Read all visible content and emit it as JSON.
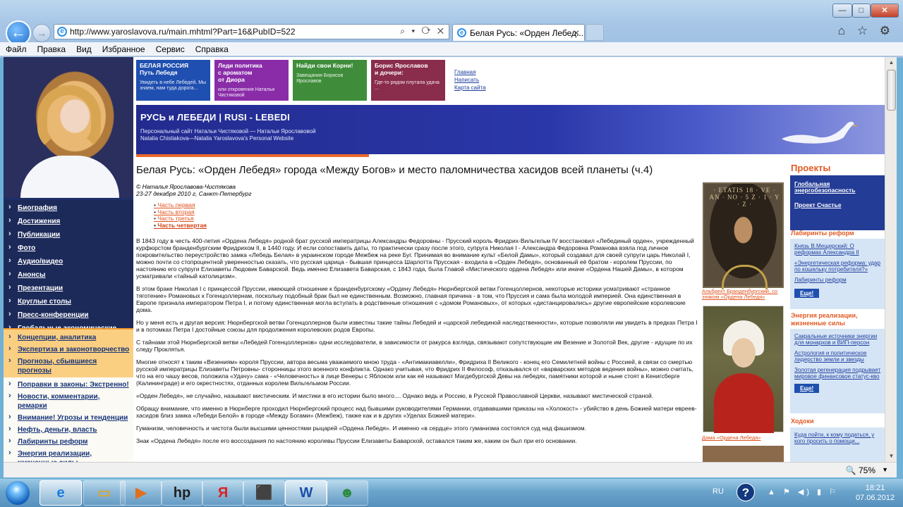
{
  "window": {
    "minimize": "—",
    "maximize": "□",
    "close": "✕"
  },
  "browser": {
    "back_icon": "arrow-left",
    "address": "http://www.yaroslavova.ru/main.mhtml?Part=16&PubID=522",
    "address_controls": "⌕ ▾ ⟳ ✕",
    "tab_title": "Белая Русь: «Орден Лебед...",
    "tab_close": "✕",
    "toolbar_icons": "⌂ ☆ ⚙"
  },
  "menu": [
    "Файл",
    "Правка",
    "Вид",
    "Избранное",
    "Сервис",
    "Справка"
  ],
  "header": {
    "banners": [
      {
        "title": "БЕЛАЯ РОССИЯ\nПуть Лебедя",
        "sub": "Увидеть в небе Лебедей, Мы знаем, нам туда дорога...",
        "color": "#1f4fb0"
      },
      {
        "title": "Леди политика\nс ароматом\nот Диора",
        "sub": "или откровения Натальи Чистяковой",
        "color": "#8a2ca8"
      },
      {
        "title": "Найди свои Корни!",
        "sub": "Завещания Борисов Ярославов",
        "color": "#3f8d3a"
      },
      {
        "title": "Борис Ярославов\nи дочери:",
        "sub": "Где-то рядом плутала удача ...",
        "color": "#8a2c4c"
      }
    ],
    "toplinks": [
      "Главная",
      "Написать",
      "Карта сайта"
    ],
    "hero_title": "РУСЬ и ЛЕБЕДИ | RUSI - LEBEDI",
    "hero_sub1": "Персональный сайт Натальи Чистяковой — Натальи Ярославовой",
    "hero_sub2": "Natalia Chistiakova—Natalia Yaroslavova's  Personal Website"
  },
  "leftnav": {
    "primary": [
      "Биография",
      "Достижения",
      "Публикации",
      "Фото",
      "Аудио/видео",
      "Анонсы",
      "Презентации",
      "Круглые столы",
      "Пресс-конференции",
      "Глобальные экономические стратегии, навигации"
    ],
    "secondary": [
      "Концепции, аналитика",
      "Экспертиза и законотворчество",
      "Прогнозы, сбывшиеся прогнозы"
    ],
    "tertiary": [
      "Поправки в законы: Экстренно!",
      "Новости, комментарии, ремарки",
      "Внимание! Угрозы и тенденции",
      "Нефть, деньги, власть",
      "Лабиринты реформ",
      "Энергия реализации, жизненные силы"
    ]
  },
  "article": {
    "title": "Белая Русь: «Орден Лебедя» города «Между Богов» и место паломничества хасидов всей планеты (ч.4)",
    "author": "© Наталья Ярославова-Чистякова",
    "date": "23-27 декабря 2010 г, Санкт-Петербург",
    "parts": [
      "Часть первая",
      "Часть вторая",
      "Часть третья",
      "Часть четвертая"
    ],
    "paragraphs": [
      "В 1843 году в честь 400-летия «Ордена Лебедя» родной брат русской императрицы Александры Федоровны - Прусский король Фридрих-Вильгельм IV восстановил «Лебединый орден», учрежденный курфюрстом бранденбургским Фридрихом II, в 1440 году. И если сопоставить даты, то практически сразу после этого, супруга Николая I - Александра Федоровна Романова взяла под личное покровительство переустройство замка «Лебедь Белая» в украинском городе Межбеж на реке Буг. Принимая во внимание культ «Белой Дамы», который создавал для своей супруги царь Николай I, можно почти со стопроцентной уверенностью сказать, что русская царица - бывшая принцесса Шарлотта Прусская - входила в «Орден Лебедя», основанный её братом - королем Пруссии, по настоянию его супруги Елизаветы Людовик Баварской. Ведь именно Елизавета Баварская, с 1843 года, была Главой «Мистического ордена Лебедя» или иначе «Ордена Нашей Дамы», в котором усматривали «тайный католицизм».",
      "В этом браке Николая I с принцессой Пруссии, имеющей отношение к бранденбургскому «Ордену Лебедя» Нюрнбергской ветви Гогенцоллернов, некоторые историки усматривают «странное тяготение» Романовых к Гогенцоллернам, поскольку подобный брак был не единственным. Возможно, главная причина - в том, что Пруссия и сама была молодой империей. Она единственная в Европе признала императором Петра I, и потому единственная могла вступать в родственные отношения с «домом Романовых», от которых «дистанцировались» другие европейские королевские дома.",
      "Но у меня есть и другая версия: Нюрнбергской ветви Гогенцоллернов были известны такие тайны Лебедей и «царской лебединой наследственности», которые позволяли им увидеть в предках Петра I и в потомках Петра I достойные союзы для продолжения королевских родов Европы.",
      "С тайнами этой Нюрнбергской ветви «Лебедей Гогенцоллернов» одни исследователи, в зависимости от ракурса взгляда, связывают сопутствующие им Везение и Золотой Век, другие - идущие по их следу Проклятья.",
      "Многие относят к таким «Везениям» короля Пруссии, автора весьма уважаемого мною труда - «Антимакиавелли», Фридриха II Великого - конец его Семилетней войны с Россией, в связи со смертью русской императрицы Елизаветы Петровны- сторонницы этого военного конфликта. Однако учитывая, что Фридрих II Философ, отказывался от «варварских методов ведения войны», можно считать, что на его чашу весов, положила «Удачу» сама - «Человечность» в лице Венеры с Яблоком или как её называют Магдебургской Девы на лебедях, памятники которой и ныне стоят в Кенигсберге (Калининграде) и его окрестностях, отданных королем Вильгельмом России.",
      "«Орден Лебедя», не случайно, называют мистическим. И мистики в его истории было много.... Однако ведь и Россию, в Русской Православной Церкви, называют мистической страной.",
      "Обращу внимание, что именно в Нюрнберге проходил Нюрнбергский процесс над бывшими руководителями Германии, отдававшими приказы на «Холокост» - убийство в день Божией матери евреев-хасидов близ замка «Лебеди Белой» в городе «Между Богами» (Межбеж), также как и в других «Уделах Божией матери».",
      "Гуманизм, человечность и чистота были высшими ценностями рыцарей «Ордена Лебедя». И именно «в сердце» этого гуманизма состоялся суд над фашизмом.",
      "Знак «Ордена Лебедя» после его воссоздания по настоянию королевы Пруссии Елизаветы Баварской, оставался таким же, каким он был при его основании."
    ],
    "image1_inscription": "· ETATIS 18 · VE · AN · NO · 5 Z · 1 · Y · Z ·",
    "image1_caption": "Альбрехт Бранденбургский, со знаком «Ордена Лебедя»",
    "image2_caption": "Дама «Ордена Лебедя»"
  },
  "sidebar": {
    "projects_title": "Проекты",
    "projects": [
      "Глобальная энергобезопасность",
      "Проект Счастье"
    ],
    "s1_title": "Лабиринты реформ",
    "s1_items": [
      "Князь В.Мещерский: О реформах Александра II",
      "«Энергетическая реформа: удар по кошельку потребителя?»",
      "Лабиринты реформ"
    ],
    "s2_title": "Энергия реализации, жизненные силы",
    "s2_items": [
      "Сакральные источники энергии для монархов и ВИП-персон",
      "Астрология и политическое лидерство земли и звезды",
      "Золотая регенерация подрывает мировое финансовое статус-кво"
    ],
    "s3_title": "Ходоки",
    "s3_items": [
      "Куда пойти, к кому податься, у кого просить о помощи..."
    ],
    "more": "Еще!"
  },
  "status": {
    "zoom": "75%"
  },
  "taskbar": {
    "lang": "RU",
    "time": "18:21",
    "date": "07.06.2012",
    "apps": [
      "ie",
      "folder",
      "media",
      "hp",
      "yandex",
      "package",
      "word",
      "users"
    ]
  }
}
